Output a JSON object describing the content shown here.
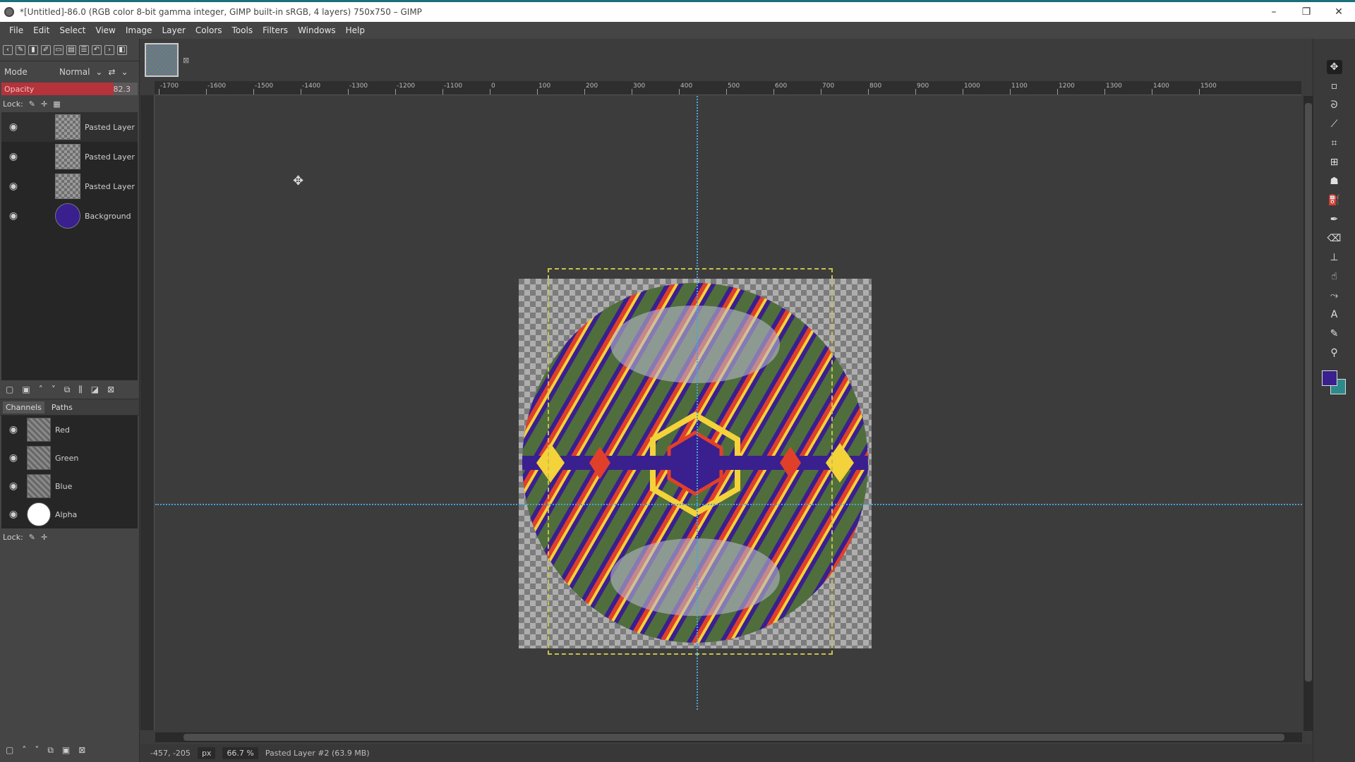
{
  "window": {
    "title": "*[Untitled]-86.0 (RGB color 8-bit gamma integer, GIMP built-in sRGB, 4 layers) 750x750 – GIMP",
    "minimize": "–",
    "maximize": "❐",
    "close": "✕"
  },
  "menu": [
    "File",
    "Edit",
    "Select",
    "View",
    "Image",
    "Layer",
    "Colors",
    "Tools",
    "Filters",
    "Windows",
    "Help"
  ],
  "layers_panel": {
    "mode_label": "Mode",
    "mode_value": "Normal",
    "opacity_label": "Opacity",
    "opacity_value": "82.3",
    "opacity_fraction": 0.823,
    "lock_label": "Lock:",
    "layers": [
      {
        "name": "Pasted Layer",
        "selected": true
      },
      {
        "name": "Pasted Layer",
        "selected": false
      },
      {
        "name": "Pasted Layer",
        "selected": false
      },
      {
        "name": "Background",
        "selected": false
      }
    ]
  },
  "channels_panel": {
    "tabs": [
      "Channels",
      "Paths"
    ],
    "channels": [
      "Red",
      "Green",
      "Blue",
      "Alpha"
    ],
    "lock_label": "Lock:"
  },
  "ruler_labels": [
    "-1700",
    "-1600",
    "-1500",
    "-1400",
    "-1300",
    "-1200",
    "-1100",
    "0",
    "100",
    "200",
    "300",
    "400",
    "500",
    "600",
    "700",
    "800",
    "900",
    "1000",
    "1100",
    "1200",
    "1300",
    "1400",
    "1500"
  ],
  "status": {
    "coords": "-457, -205",
    "unit": "px",
    "zoom": "66.7 %",
    "message": "Pasted Layer #2 (63.9 MB)"
  },
  "colors": {
    "foreground": "#3a1f8f",
    "background": "#2e8a8a"
  },
  "tools": [
    "move-icon",
    "rect-select-icon",
    "lasso-icon",
    "fuzzy-select-icon",
    "crop-icon",
    "unified-transform-icon",
    "warp-icon",
    "bucket-fill-icon",
    "paintbrush-icon",
    "eraser-icon",
    "clone-icon",
    "smudge-icon",
    "paths-icon",
    "text-icon",
    "color-picker-icon",
    "zoom-icon"
  ]
}
